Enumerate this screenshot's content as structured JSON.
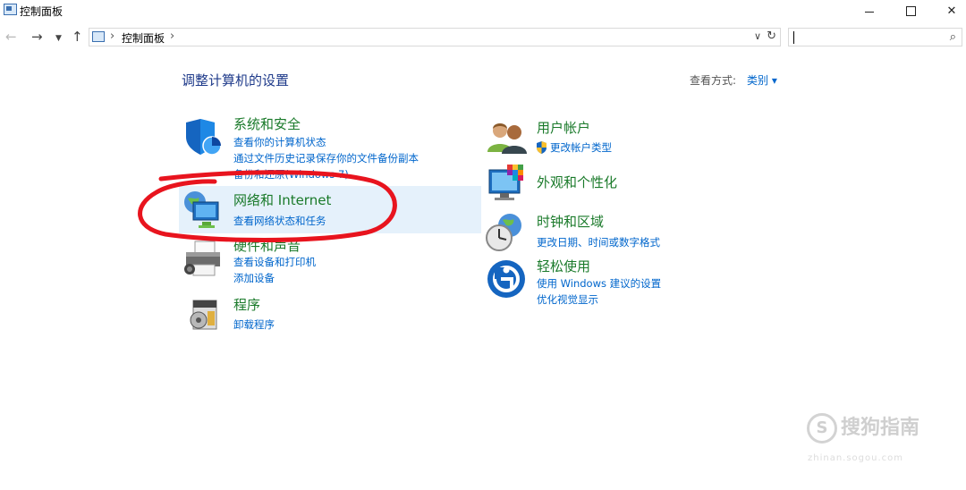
{
  "window": {
    "title": "控制面板"
  },
  "address": {
    "crumb": "控制面板",
    "search_placeholder": ""
  },
  "main": {
    "heading": "调整计算机的设置",
    "view_by_label": "查看方式:",
    "view_by_value": "类别 ▾"
  },
  "categories": {
    "system": {
      "title": "系统和安全",
      "links": [
        "查看你的计算机状态",
        "通过文件历史记录保存你的文件备份副本",
        "备份和还原(Windows 7)"
      ]
    },
    "network": {
      "title": "网络和 Internet",
      "links": [
        "查看网络状态和任务"
      ]
    },
    "hardware": {
      "title": "硬件和声音",
      "links": [
        "查看设备和打印机",
        "添加设备"
      ]
    },
    "programs": {
      "title": "程序",
      "links": [
        "卸载程序"
      ]
    },
    "user": {
      "title": "用户帐户",
      "links": [
        "更改帐户类型"
      ]
    },
    "appearance": {
      "title": "外观和个性化",
      "links": []
    },
    "clock": {
      "title": "时钟和区域",
      "links": [
        "更改日期、时间或数字格式"
      ]
    },
    "ease": {
      "title": "轻松使用",
      "links": [
        "使用 Windows 建议的设置",
        "优化视觉显示"
      ]
    }
  },
  "watermark": {
    "brand": "搜狗指南",
    "logo_char": "S",
    "sub": "zhinan.sogou.com"
  },
  "colors": {
    "title_green": "#1a7a2a",
    "link_blue": "#0066cc",
    "highlight": "#e5f1fb",
    "annotation_red": "#e8141e"
  }
}
